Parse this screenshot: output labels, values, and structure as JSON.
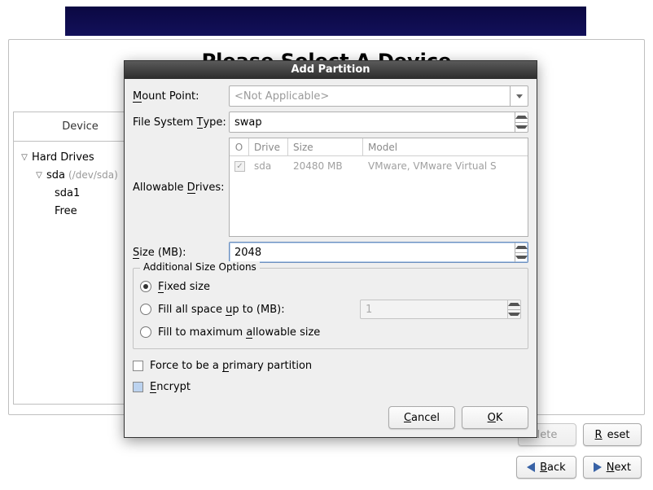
{
  "main": {
    "title": "Please Select A Device"
  },
  "tree": {
    "header": "Device",
    "root": "Hard Drives",
    "drive": "sda",
    "drive_path": "(/dev/sda)",
    "children": [
      "sda1",
      "Free"
    ]
  },
  "footer": {
    "delete": "lete",
    "reset_u": "R",
    "reset": "eset",
    "back_u": "B",
    "back": "ack",
    "next_u": "N",
    "next": "ext"
  },
  "dialog": {
    "title": "Add Partition",
    "mount_label_u": "M",
    "mount_label": "ount Point:",
    "mount_placeholder": "<Not Applicable>",
    "fs_label_u": "T",
    "fs_label_pre": "File System ",
    "fs_label_post": "ype:",
    "fs_value": "swap",
    "drives_label_u": "D",
    "drives_label_pre": "Allowable ",
    "drives_label_post": "rives:",
    "drives_head": {
      "o": "O",
      "drive": "Drive",
      "size": "Size",
      "model": "Model"
    },
    "drives_row": {
      "name": "sda",
      "size": "20480 MB",
      "model": "VMware, VMware Virtual S"
    },
    "size_label_u": "S",
    "size_label": "ize (MB):",
    "size_value": "2048",
    "addl_title": "Additional Size Options",
    "opt_fixed_u": "F",
    "opt_fixed": "ixed size",
    "opt_fillup_pre": "Fill all space ",
    "opt_fillup_u": "u",
    "opt_fillup_post": "p to (MB):",
    "fillup_value": "1",
    "opt_max_pre": "Fill to maximum ",
    "opt_max_u": "a",
    "opt_max_post": "llowable size",
    "chk_primary_pre": "Force to be a ",
    "chk_primary_u": "p",
    "chk_primary_post": "rimary partition",
    "chk_encrypt_u": "E",
    "chk_encrypt": "ncrypt",
    "cancel_u": "C",
    "cancel": "ancel",
    "ok_u": "O",
    "ok": "K"
  }
}
